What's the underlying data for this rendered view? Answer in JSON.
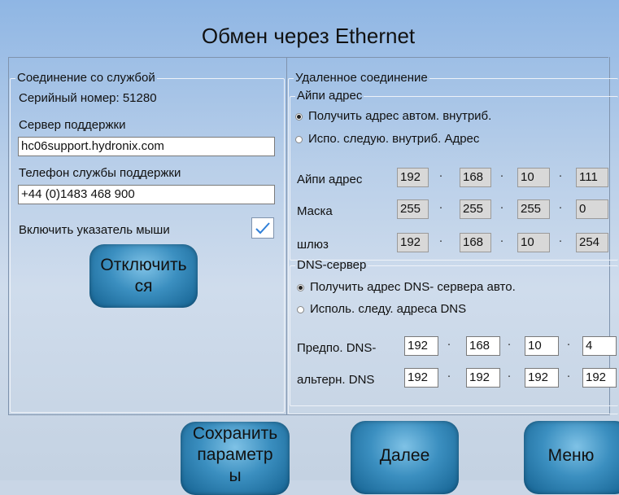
{
  "title": "Обмен через Ethernet",
  "left": {
    "group_title": "Соединение со службой",
    "serial_label": "Серийный номер: 51280",
    "server_label": "Сервер поддержки",
    "server_value": "hc06support.hydronix.com",
    "phone_label": "Телефон службы поддержки",
    "phone_value": "+44 (0)1483 468 900",
    "mouse_label": "Включить указатель мыши",
    "mouse_checked": true,
    "disconnect_label": "Отключить\nся"
  },
  "right": {
    "group_title": "Удаленное соединение",
    "ip_group_title": "Айпи адрес",
    "ip_auto_label": "Получить адрес автом. внутриб.",
    "ip_manual_label": "Испо. следую. внутриб. Адрес",
    "ip_label": "Айпи адрес",
    "ip": [
      "192",
      "168",
      "10",
      "111"
    ],
    "mask_label": "Маска",
    "mask": [
      "255",
      "255",
      "255",
      "0"
    ],
    "gateway_label": "шлюз",
    "gateway": [
      "192",
      "168",
      "10",
      "254"
    ],
    "dns_group_title": "DNS-сервер",
    "dns_auto_label": "Получить адрес DNS- сервера авто.",
    "dns_manual_label": "Исполь. следу. адреса DNS",
    "pref_dns_label": "Предпо. DNS-",
    "pref_dns": [
      "192",
      "168",
      "10",
      "4"
    ],
    "alt_dns_label": "альтерн. DNS",
    "alt_dns": [
      "192",
      "192",
      "192",
      "192"
    ],
    "separator": "·"
  },
  "buttons": {
    "save_label": "Сохранить\nпараметр\nы",
    "next_label": "Далее",
    "menu_label": "Меню"
  }
}
